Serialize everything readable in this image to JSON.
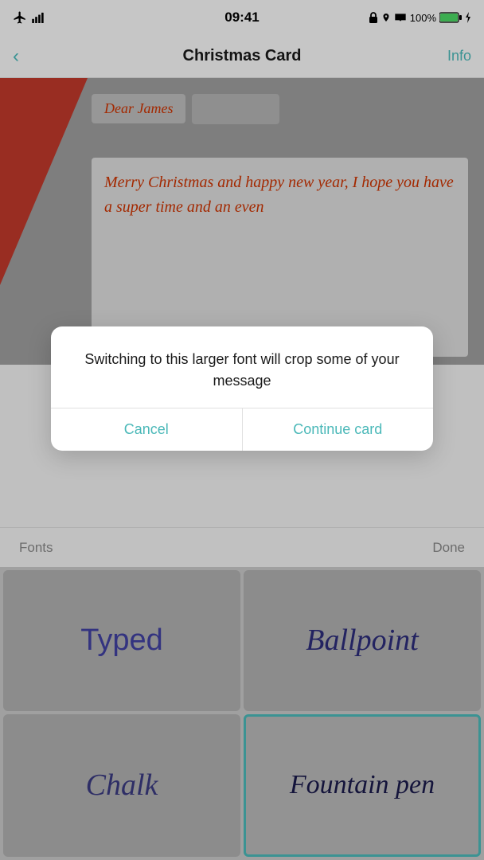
{
  "statusBar": {
    "time": "09:41",
    "batteryPercent": "100%"
  },
  "navBar": {
    "title": "Christmas Card",
    "backLabel": "‹",
    "infoLabel": "Info"
  },
  "cardPreview": {
    "salutation": "Dear James",
    "message": "Merry Christmas and happy new year, I hope you have a super time and an even"
  },
  "dialog": {
    "message": "Switching to this larger font will crop some of your message",
    "cancelLabel": "Cancel",
    "continueLabel": "Continue card"
  },
  "bottomToolbar": {
    "fontsLabel": "Fonts",
    "doneLabel": "Done"
  },
  "fontGrid": {
    "tiles": [
      {
        "id": "typed",
        "label": "Typed",
        "selected": false
      },
      {
        "id": "ballpoint",
        "label": "Ballpoint",
        "selected": false
      },
      {
        "id": "chalk",
        "label": "Chalk",
        "selected": false
      },
      {
        "id": "fountain",
        "label": "Fountain pen",
        "selected": true
      }
    ]
  },
  "colors": {
    "accent": "#4ab8b8",
    "cardText": "#cc3300",
    "fontTileSelected": "#4ab8b8"
  }
}
